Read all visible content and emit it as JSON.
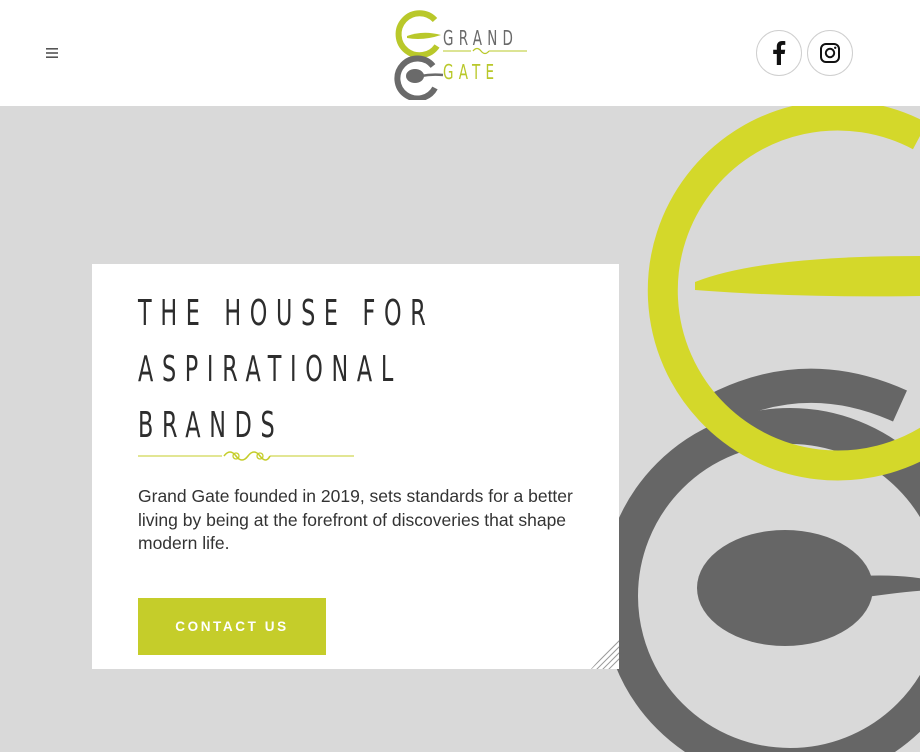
{
  "header": {
    "menu_icon": "hamburger-icon",
    "logo": {
      "word_top": "GRAND",
      "word_bottom": "GATE"
    },
    "social": [
      {
        "name": "facebook",
        "icon": "facebook-icon"
      },
      {
        "name": "instagram",
        "icon": "instagram-icon"
      }
    ]
  },
  "hero": {
    "headline_lines": [
      "THE HOUSE FOR",
      "ASPIRATIONAL",
      "BRANDS"
    ],
    "description": "Grand Gate founded in 2019, sets standards for a better living by being at the forefront of discoveries that shape modern life.",
    "cta_label": "CONTACT US"
  },
  "colors": {
    "accent_lime": "#c5cd2a",
    "logo_gray": "#6a6a6a",
    "hero_bg": "#d9d9d9",
    "art_gray": "#666666",
    "text_dark": "#2d2d2d"
  }
}
